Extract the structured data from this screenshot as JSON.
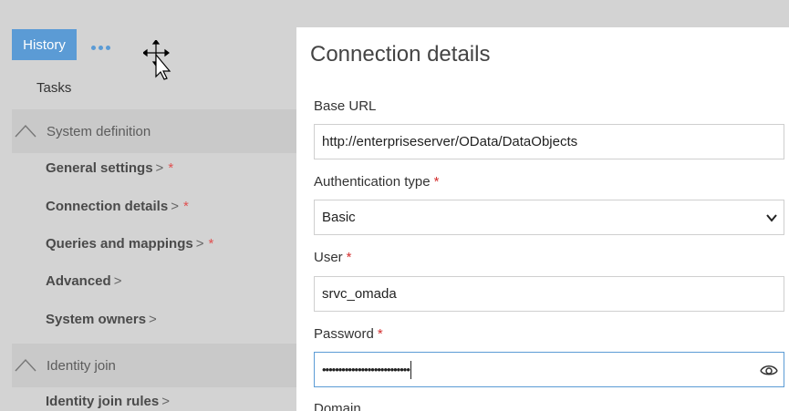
{
  "sidebar": {
    "history_label": "History",
    "tasks_label": "Tasks",
    "sections": [
      {
        "label": "System definition",
        "items": [
          {
            "label": "General settings",
            "arrow": ">",
            "required": "*"
          },
          {
            "label": "Connection details",
            "arrow": ">",
            "required": "*"
          },
          {
            "label": "Queries and mappings",
            "arrow": ">",
            "required": "*"
          },
          {
            "label": "Advanced",
            "arrow": ">"
          },
          {
            "label": "System owners",
            "arrow": ">"
          }
        ]
      },
      {
        "label": "Identity join",
        "items": [
          {
            "label": "Identity join rules",
            "arrow": ">"
          }
        ]
      }
    ]
  },
  "form": {
    "title": "Connection details",
    "required_marker": "*",
    "base_url": {
      "label": "Base URL",
      "value": "http://enterpriseserver/OData/DataObjects"
    },
    "auth_type": {
      "label": "Authentication type",
      "value": "Basic"
    },
    "user": {
      "label": "User",
      "value": "srvc_omada"
    },
    "password": {
      "label": "Password",
      "value": "•••••••••••••••••••••••••••"
    },
    "domain": {
      "label": "Domain"
    }
  },
  "colors": {
    "accent": "#5b9bd5",
    "required": "#d32f2f",
    "sidebar_bg": "#d3d3d3"
  },
  "icons": [
    "more-dots-icon",
    "move-cursor-icon",
    "chevron-up-icon",
    "chevron-down-icon",
    "eye-icon"
  ]
}
